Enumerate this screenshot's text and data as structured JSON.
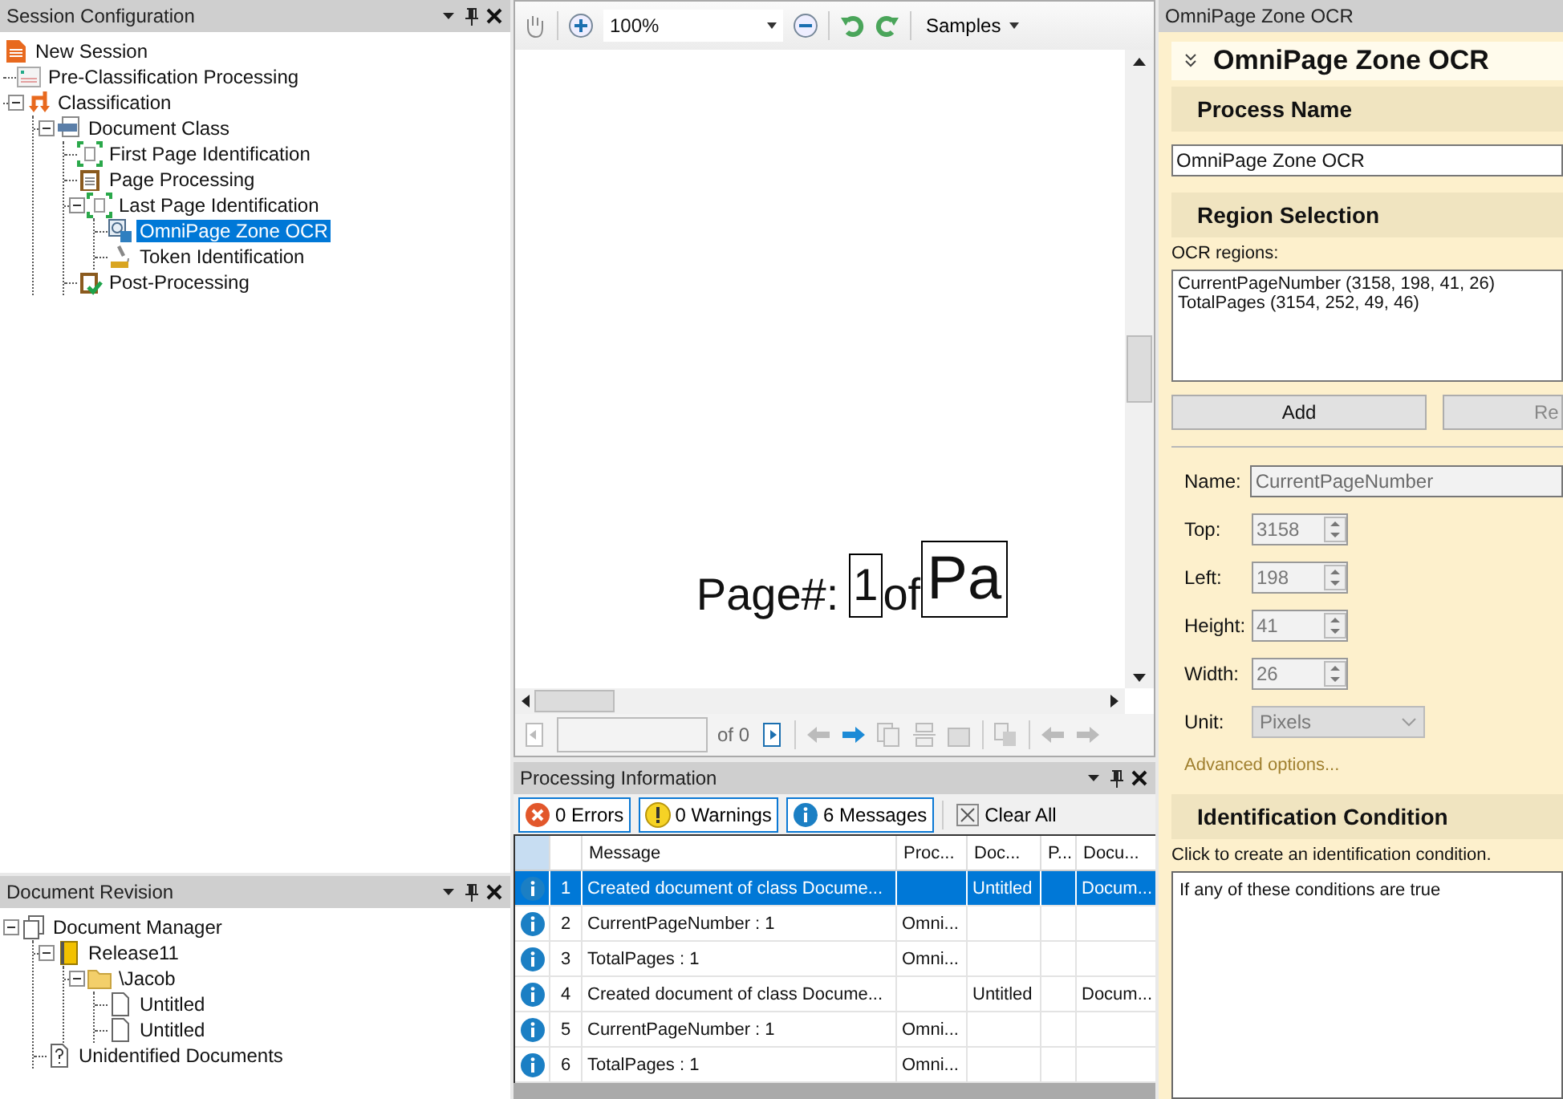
{
  "session_configuration": {
    "title": "Session Configuration",
    "tree": [
      {
        "label": "New Session",
        "kind": "session",
        "selected": false
      },
      {
        "label": "Pre-Classification Processing",
        "kind": "process",
        "selected": false
      },
      {
        "label": "Classification",
        "kind": "classification",
        "selected": false,
        "expanded": true,
        "children": [
          {
            "label": "Document Class",
            "kind": "class",
            "selected": false,
            "expanded": true,
            "children": [
              {
                "label": "First Page Identification",
                "kind": "identification",
                "selected": false
              },
              {
                "label": "Page Processing",
                "kind": "clipboard",
                "selected": false
              },
              {
                "label": "Last Page Identification",
                "kind": "identification",
                "selected": false,
                "expanded": true,
                "children": [
                  {
                    "label": "OmniPage Zone OCR",
                    "kind": "ocr",
                    "selected": true
                  },
                  {
                    "label": "Token Identification",
                    "kind": "token",
                    "selected": false
                  }
                ]
              },
              {
                "label": "Post-Processing",
                "kind": "postprocess",
                "selected": false
              }
            ]
          }
        ]
      }
    ]
  },
  "document_revision": {
    "title": "Document Revision",
    "tree": [
      {
        "label": "Document Manager",
        "kind": "manager",
        "expanded": true,
        "children": [
          {
            "label": "Release11",
            "kind": "book",
            "expanded": true,
            "children": [
              {
                "label": "\\Jacob",
                "kind": "folder",
                "expanded": true,
                "children": [
                  {
                    "label": "Untitled",
                    "kind": "document"
                  },
                  {
                    "label": "Untitled",
                    "kind": "document"
                  }
                ]
              }
            ]
          },
          {
            "label": "Unidentified Documents",
            "kind": "unknown"
          }
        ]
      }
    ]
  },
  "viewer": {
    "zoom": "100%",
    "samples": "Samples",
    "page_text": "Page#:",
    "zones": [
      "1",
      "Pa"
    ],
    "between": "of",
    "page_of": "of 0"
  },
  "processing_information": {
    "title": "Processing Information",
    "filters": [
      {
        "label": "0 Errors",
        "kind": "error",
        "on": true
      },
      {
        "label": "0 Warnings",
        "kind": "warning",
        "on": true
      },
      {
        "label": "6 Messages",
        "kind": "info",
        "on": true
      }
    ],
    "clear": "Clear All",
    "columns": [
      "Message",
      "Proc...",
      "Doc...",
      "P...",
      "Docu..."
    ],
    "rows": [
      {
        "number": "1",
        "selected": true,
        "cells": [
          "Created document of class Docume...",
          null,
          "Untitled",
          null,
          "Docum..."
        ]
      },
      {
        "number": "2",
        "selected": false,
        "cells": [
          "CurrentPageNumber : 1",
          "Omni...",
          null,
          null,
          null
        ]
      },
      {
        "number": "3",
        "selected": false,
        "cells": [
          "TotalPages : 1",
          "Omni...",
          null,
          null,
          null
        ]
      },
      {
        "number": "4",
        "selected": false,
        "cells": [
          "Created document of class Docume...",
          null,
          "Untitled",
          null,
          "Docum..."
        ]
      },
      {
        "number": "5",
        "selected": false,
        "cells": [
          "CurrentPageNumber : 1",
          "Omni...",
          null,
          null,
          null
        ]
      },
      {
        "number": "6",
        "selected": false,
        "cells": [
          "TotalPages : 1",
          "Omni...",
          null,
          null,
          null
        ]
      }
    ]
  },
  "properties": {
    "title": "OmniPage Zone OCR",
    "header": "OmniPage Zone OCR",
    "process_name": {
      "heading": "Process Name",
      "value": "OmniPage Zone OCR"
    },
    "region_selection": {
      "heading": "Region Selection",
      "label": "OCR regions:",
      "regions": [
        "CurrentPageNumber (3158, 198, 41, 26)",
        "TotalPages (3154, 252, 49, 46)"
      ],
      "buttons": [
        "Add",
        "Re"
      ],
      "name": {
        "label": "Name:",
        "value": "CurrentPageNumber",
        "disabled": true
      },
      "spinners": [
        {
          "label": "Top:",
          "value": "3158",
          "disabled": true
        },
        {
          "label": "Left:",
          "value": "198",
          "disabled": true
        },
        {
          "label": "Height:",
          "value": "41",
          "disabled": true
        },
        {
          "label": "Width:",
          "value": "26",
          "disabled": true
        }
      ],
      "unit": {
        "label": "Unit:",
        "value": "Pixels",
        "disabled": true
      },
      "advanced": "Advanced options..."
    },
    "identification_condition": {
      "heading": "Identification Condition",
      "hint": "Click to create an identification condition.",
      "condition": "If any of these conditions are true"
    }
  }
}
